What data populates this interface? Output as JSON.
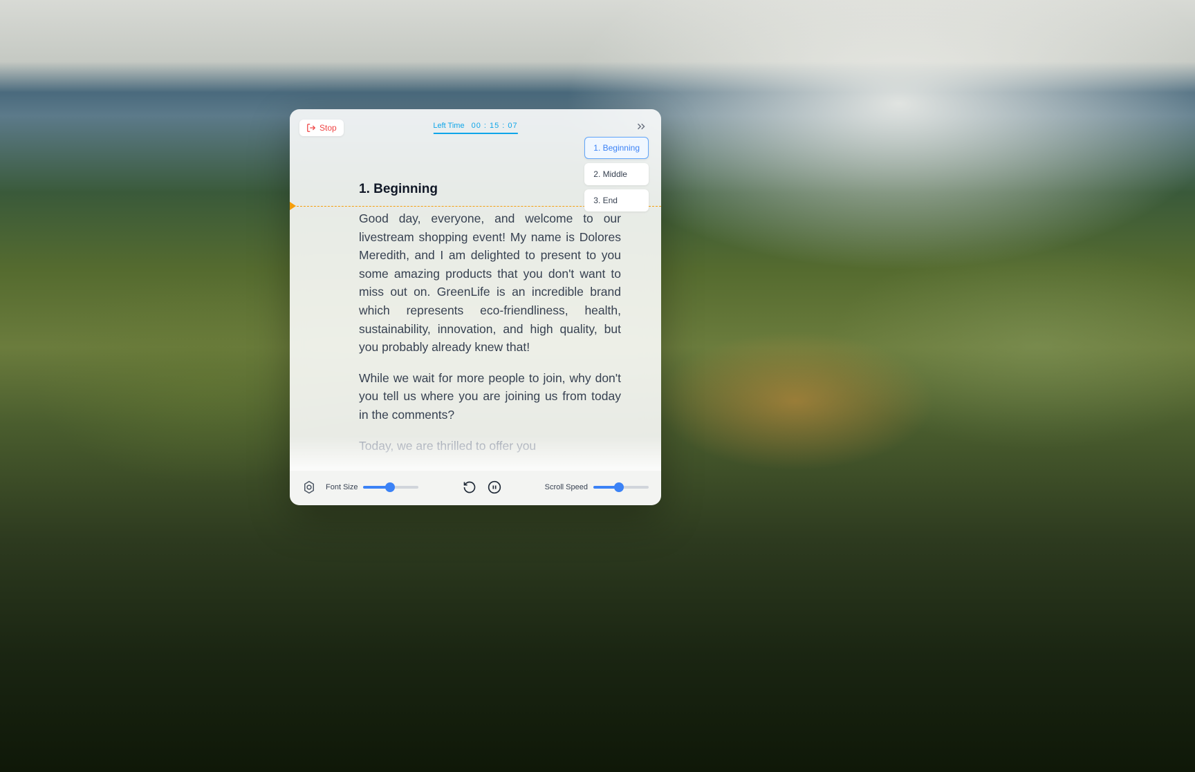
{
  "header": {
    "stop_label": "Stop",
    "time_label": "Left Time",
    "time_value": "00 : 15 : 07"
  },
  "nav": {
    "items": [
      {
        "label": "1. Beginning",
        "active": true
      },
      {
        "label": "2. Middle",
        "active": false
      },
      {
        "label": "3. End",
        "active": false
      }
    ]
  },
  "script": {
    "title": "1. Beginning",
    "paragraphs": [
      "Good day, everyone, and welcome to our livestream shopping event! My name is Dolores Meredith, and I am delighted to present to you some amazing products that you don't want to miss out on. GreenLife is an incredible brand which represents eco-friendliness, health, sustainability, innovation, and high quality, but you probably already knew that!",
      "While we wait for more people to join, why don't you tell us where you are joining us from today in the comments?",
      "Today, we are thrilled to offer you"
    ]
  },
  "footer": {
    "font_size_label": "Font Size",
    "font_size_value": 48,
    "scroll_speed_label": "Scroll Speed",
    "scroll_speed_value": 45
  }
}
